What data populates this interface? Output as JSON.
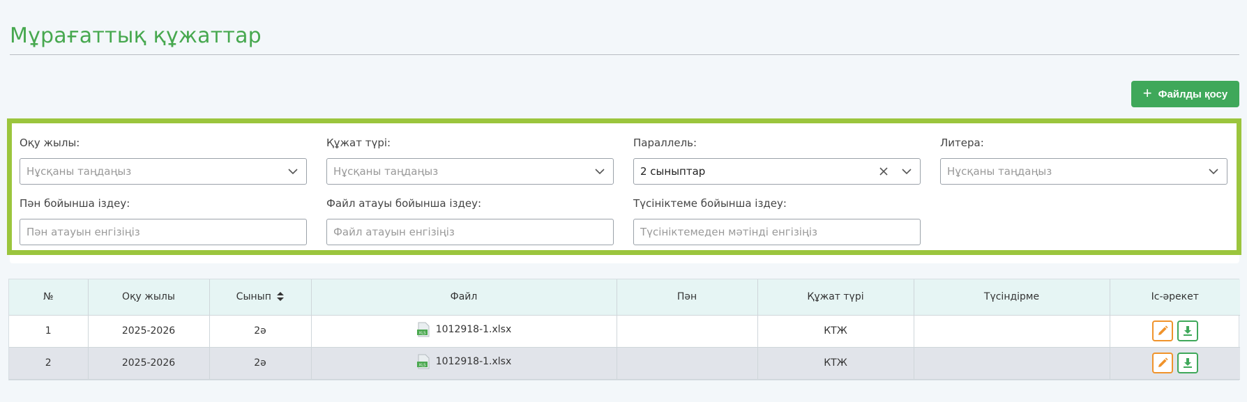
{
  "page": {
    "title": "Мұрағаттық құжаттар"
  },
  "actions": {
    "add_file": "Файлды қосу"
  },
  "filters": {
    "year": {
      "label": "Оқу жылы:",
      "placeholder": "Нұсқаны таңдаңыз"
    },
    "doc_type": {
      "label": "Құжат түрі:",
      "placeholder": "Нұсқаны таңдаңыз"
    },
    "parallel": {
      "label": "Параллель:",
      "value": "2 сыныптар"
    },
    "letter": {
      "label": "Литера:",
      "placeholder": "Нұсқаны таңдаңыз"
    },
    "subject": {
      "label": "Пән бойынша іздеу:",
      "placeholder": "Пән атауын енгізіңіз"
    },
    "filename": {
      "label": "Файл атауы бойынша іздеу:",
      "placeholder": "Файл атауын енгізіңіз"
    },
    "comment": {
      "label": "Түсініктеме бойынша іздеу:",
      "placeholder": "Түсініктемеден мәтінді енгізіңіз"
    }
  },
  "table": {
    "headers": {
      "num": "№",
      "year": "Оқу жылы",
      "class": "Сынып",
      "file": "Файл",
      "subject": "Пән",
      "doc_type": "Құжат түрі",
      "comment": "Түсіндірме",
      "actions": "Іс-әрекет"
    },
    "rows": [
      {
        "num": "1",
        "year": "2025-2026",
        "class": "2ә",
        "file": "1012918-1.xlsx",
        "subject": "",
        "doc_type": "КТЖ",
        "comment": ""
      },
      {
        "num": "2",
        "year": "2025-2026",
        "class": "2ә",
        "file": "1012918-1.xlsx",
        "subject": "",
        "doc_type": "КТЖ",
        "comment": ""
      }
    ]
  },
  "colors": {
    "accent_green": "#47a84f",
    "button_green": "#3fa85a",
    "filter_border": "#9bc53d",
    "header_bg": "#e6f5f4",
    "edit_orange": "#f0932b"
  },
  "icons": {
    "add": "plus-icon",
    "select": "chevron-down-icon",
    "clear": "close-icon",
    "sort": "sort-icon",
    "file": "xls-file-icon",
    "edit": "pencil-icon",
    "download": "download-icon"
  }
}
